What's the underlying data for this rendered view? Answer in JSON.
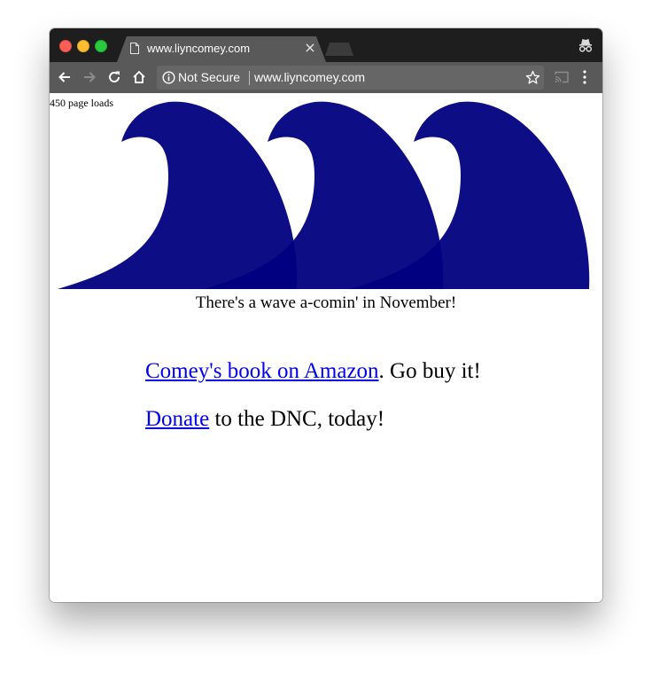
{
  "browser": {
    "tab_title": "www.liyncomey.com",
    "tab_close": "×",
    "security_label": "Not Secure",
    "url": "www.liyncomey.com"
  },
  "page": {
    "page_loads": "450 page loads",
    "wave_color": "#000080",
    "caption": "There's a wave a-comin' in November!",
    "book_link": "Comey's book on Amazon",
    "book_suffix": ". Go buy it!",
    "donate_link": "Donate",
    "donate_suffix": " to the DNC, today!",
    "link_color": "#0000ee"
  },
  "icons": {
    "traffic_lights": [
      "close",
      "minimize",
      "maximize"
    ],
    "toolbar": [
      "back-arrow-icon",
      "forward-arrow-icon",
      "reload-icon",
      "home-icon",
      "info-icon",
      "star-icon",
      "cast-icon",
      "menu-icon"
    ]
  }
}
